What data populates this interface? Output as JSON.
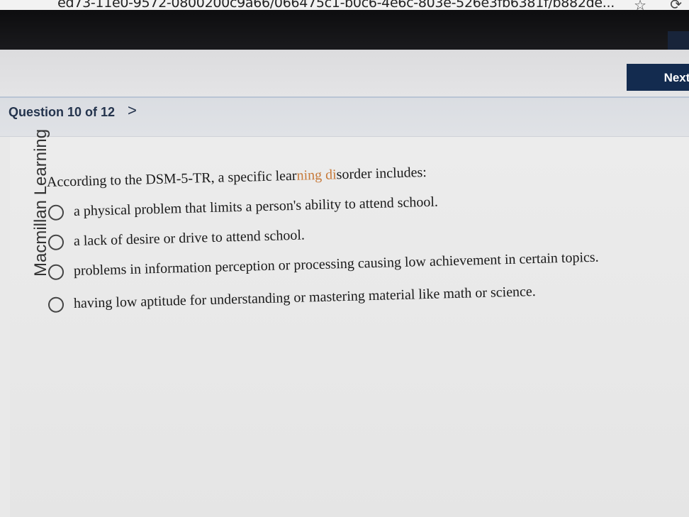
{
  "browser": {
    "url": "ed73-11e0-9572-0800200c9a66/066475c1-b0c6-4e6c-803e-526e3fb6381f/b882de..."
  },
  "header": {
    "next_label": "Next"
  },
  "question": {
    "title": "Question 10 of 12",
    "sidebar_brand": "Macmillan Learning",
    "prompt_before": "According to the DSM-5-TR, a specific lear",
    "prompt_hl": "ning di",
    "prompt_after": "sorder includes:",
    "options": [
      "a physical problem that limits a person's ability to attend school.",
      "a lack of desire or drive to attend school.",
      "problems in information perception or processing causing low achievement in certain topics.",
      "having low aptitude for understanding or mastering material like math or science."
    ]
  }
}
